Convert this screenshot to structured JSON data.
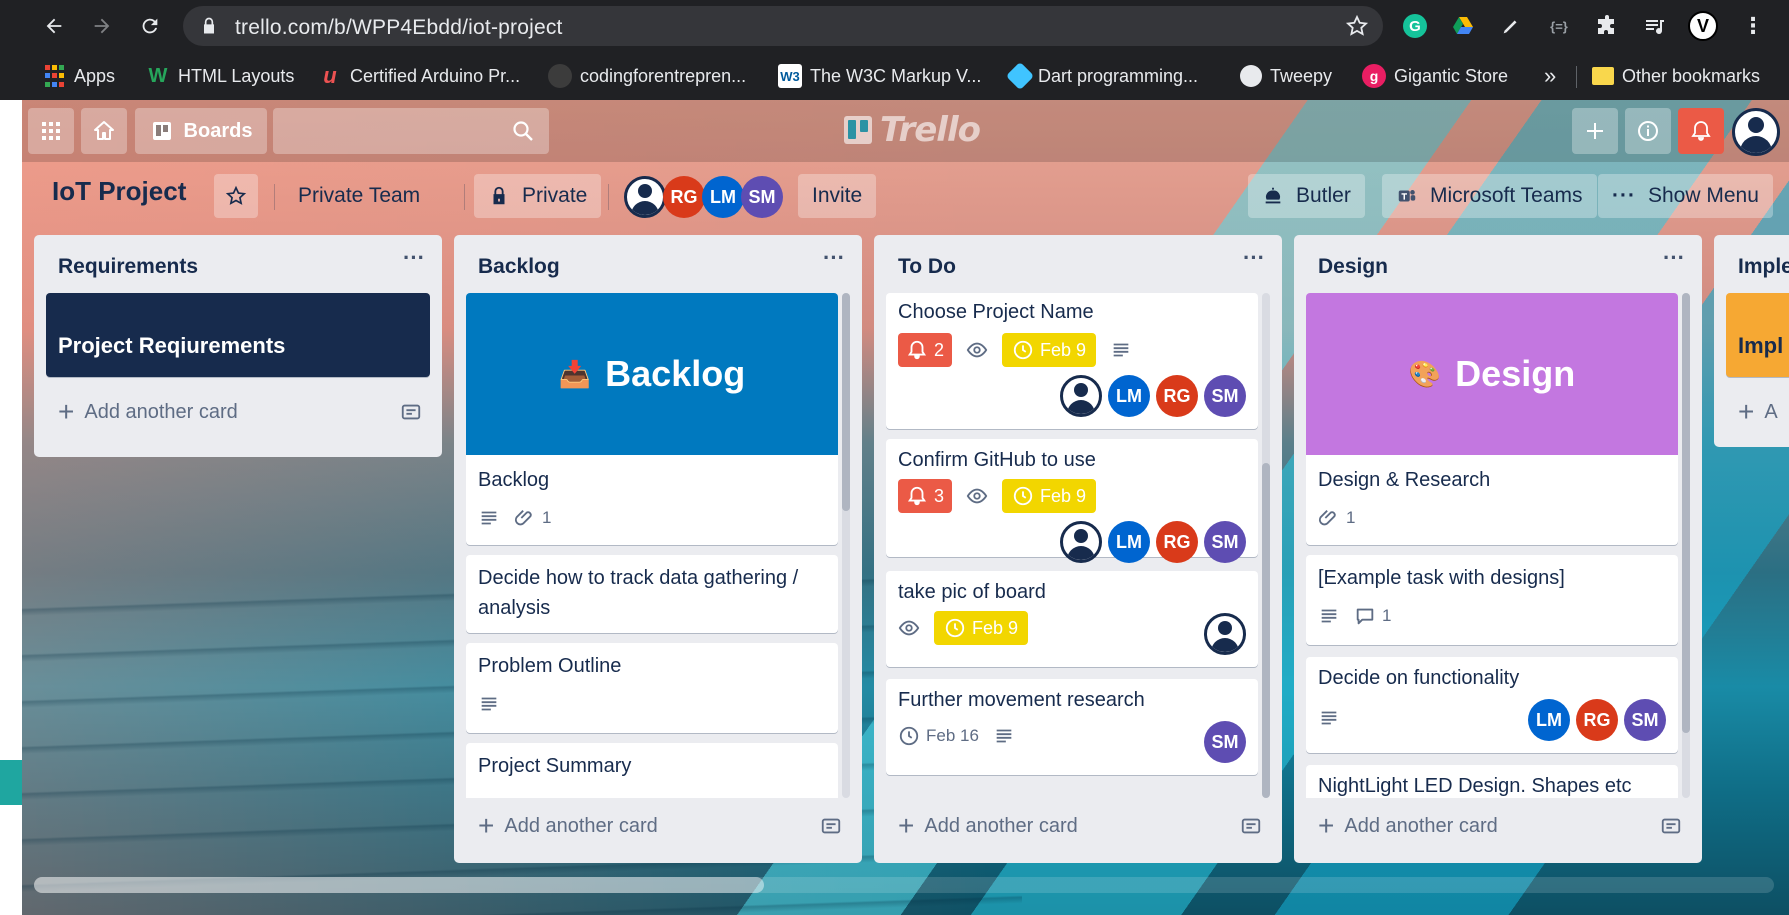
{
  "browser": {
    "url": "trello.com/b/WPP4Ebdd/iot-project",
    "bookmarks": [
      {
        "label": "Apps",
        "icon": "apps-grid-icon"
      },
      {
        "label": "HTML Layouts",
        "icon": "w-logo-icon"
      },
      {
        "label": "Certified Arduino Pr...",
        "icon": "udemy-icon"
      },
      {
        "label": "codingforentrepren...",
        "icon": "github-icon"
      },
      {
        "label": "The W3C Markup V...",
        "icon": "w3c-icon"
      },
      {
        "label": "Dart programming...",
        "icon": "dart-icon"
      },
      {
        "label": "Tweepy",
        "icon": "globe-icon"
      },
      {
        "label": "Gigantic Store",
        "icon": "gigantic-icon"
      },
      {
        "label": "Other bookmarks",
        "icon": "folder-icon"
      }
    ],
    "more_bookmarks": "»"
  },
  "trello": {
    "boards_label": "Boards",
    "logo_text": "Trello",
    "board_title": "IoT Project",
    "team_label": "Private Team",
    "visibility_label": "Private",
    "members": [
      "RG",
      "LM",
      "SM"
    ],
    "invite_label": "Invite",
    "butler_label": "Butler",
    "teams_label": "Microsoft Teams",
    "show_menu_label": "Show Menu",
    "add_card_label": "Add another card",
    "colors": {
      "red": "#eb5a46",
      "yellow": "#f2d600",
      "lm": "#0065d0",
      "rg": "#d93a1a",
      "sm": "#5e4db2",
      "navy": "#172b4d",
      "backlog_cover": "#0079bf",
      "design_cover": "#c377e0"
    }
  },
  "lists": {
    "requirements": {
      "title": "Requirements",
      "cards": [
        {
          "title": "Project Reqiurements"
        }
      ]
    },
    "backlog": {
      "title": "Backlog",
      "cover_text": "Backlog",
      "cards": [
        {
          "title": "Backlog",
          "attachments": "1"
        },
        {
          "title": "Decide how to track data gathering / analysis"
        },
        {
          "title": "Problem Outline"
        },
        {
          "title": "Project Summary"
        }
      ]
    },
    "todo": {
      "title": "To Do",
      "cards": [
        {
          "title": "Choose Project Name",
          "notifications": "2",
          "due": "Feb 9"
        },
        {
          "title": "Confirm GitHub to use",
          "notifications": "3",
          "due": "Feb 9"
        },
        {
          "title": "take pic of board",
          "due": "Feb 9"
        },
        {
          "title": "Further movement research",
          "due": "Feb 16"
        }
      ]
    },
    "design": {
      "title": "Design",
      "cover_text": "Design",
      "cards": [
        {
          "title": "Design & Research",
          "attachments": "1"
        },
        {
          "title": "[Example task with designs]",
          "comments": "1"
        },
        {
          "title": "Decide on functionality"
        },
        {
          "title": "NightLight LED Design. Shapes etc"
        }
      ]
    },
    "implementation": {
      "title": "Imple",
      "cards": [
        {
          "title": "Impl"
        }
      ],
      "add_label": "A"
    }
  }
}
